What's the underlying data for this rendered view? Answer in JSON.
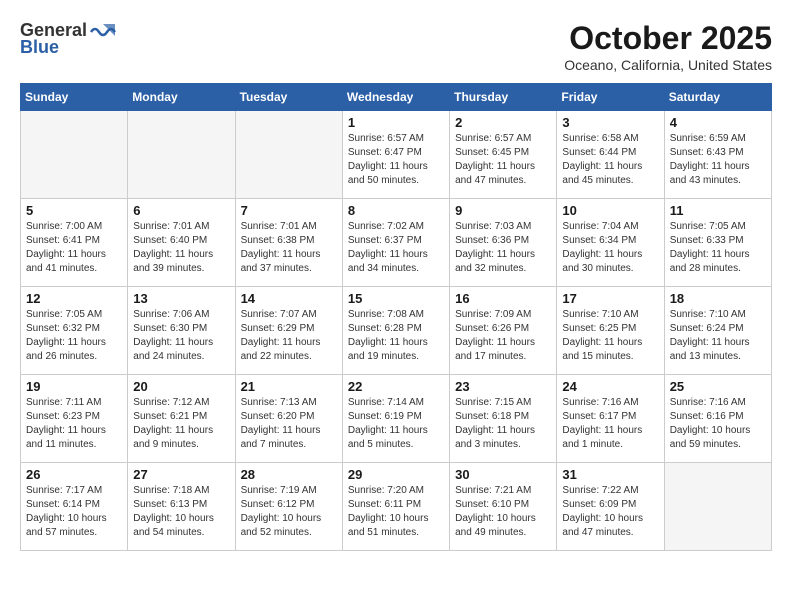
{
  "header": {
    "logo_general": "General",
    "logo_blue": "Blue",
    "month_title": "October 2025",
    "location": "Oceano, California, United States"
  },
  "weekdays": [
    "Sunday",
    "Monday",
    "Tuesday",
    "Wednesday",
    "Thursday",
    "Friday",
    "Saturday"
  ],
  "weeks": [
    [
      {
        "num": "",
        "empty": true
      },
      {
        "num": "",
        "empty": true
      },
      {
        "num": "",
        "empty": true
      },
      {
        "num": "1",
        "info": "Sunrise: 6:57 AM\nSunset: 6:47 PM\nDaylight: 11 hours\nand 50 minutes."
      },
      {
        "num": "2",
        "info": "Sunrise: 6:57 AM\nSunset: 6:45 PM\nDaylight: 11 hours\nand 47 minutes."
      },
      {
        "num": "3",
        "info": "Sunrise: 6:58 AM\nSunset: 6:44 PM\nDaylight: 11 hours\nand 45 minutes."
      },
      {
        "num": "4",
        "info": "Sunrise: 6:59 AM\nSunset: 6:43 PM\nDaylight: 11 hours\nand 43 minutes."
      }
    ],
    [
      {
        "num": "5",
        "info": "Sunrise: 7:00 AM\nSunset: 6:41 PM\nDaylight: 11 hours\nand 41 minutes."
      },
      {
        "num": "6",
        "info": "Sunrise: 7:01 AM\nSunset: 6:40 PM\nDaylight: 11 hours\nand 39 minutes."
      },
      {
        "num": "7",
        "info": "Sunrise: 7:01 AM\nSunset: 6:38 PM\nDaylight: 11 hours\nand 37 minutes."
      },
      {
        "num": "8",
        "info": "Sunrise: 7:02 AM\nSunset: 6:37 PM\nDaylight: 11 hours\nand 34 minutes."
      },
      {
        "num": "9",
        "info": "Sunrise: 7:03 AM\nSunset: 6:36 PM\nDaylight: 11 hours\nand 32 minutes."
      },
      {
        "num": "10",
        "info": "Sunrise: 7:04 AM\nSunset: 6:34 PM\nDaylight: 11 hours\nand 30 minutes."
      },
      {
        "num": "11",
        "info": "Sunrise: 7:05 AM\nSunset: 6:33 PM\nDaylight: 11 hours\nand 28 minutes."
      }
    ],
    [
      {
        "num": "12",
        "info": "Sunrise: 7:05 AM\nSunset: 6:32 PM\nDaylight: 11 hours\nand 26 minutes."
      },
      {
        "num": "13",
        "info": "Sunrise: 7:06 AM\nSunset: 6:30 PM\nDaylight: 11 hours\nand 24 minutes."
      },
      {
        "num": "14",
        "info": "Sunrise: 7:07 AM\nSunset: 6:29 PM\nDaylight: 11 hours\nand 22 minutes."
      },
      {
        "num": "15",
        "info": "Sunrise: 7:08 AM\nSunset: 6:28 PM\nDaylight: 11 hours\nand 19 minutes."
      },
      {
        "num": "16",
        "info": "Sunrise: 7:09 AM\nSunset: 6:26 PM\nDaylight: 11 hours\nand 17 minutes."
      },
      {
        "num": "17",
        "info": "Sunrise: 7:10 AM\nSunset: 6:25 PM\nDaylight: 11 hours\nand 15 minutes."
      },
      {
        "num": "18",
        "info": "Sunrise: 7:10 AM\nSunset: 6:24 PM\nDaylight: 11 hours\nand 13 minutes."
      }
    ],
    [
      {
        "num": "19",
        "info": "Sunrise: 7:11 AM\nSunset: 6:23 PM\nDaylight: 11 hours\nand 11 minutes."
      },
      {
        "num": "20",
        "info": "Sunrise: 7:12 AM\nSunset: 6:21 PM\nDaylight: 11 hours\nand 9 minutes."
      },
      {
        "num": "21",
        "info": "Sunrise: 7:13 AM\nSunset: 6:20 PM\nDaylight: 11 hours\nand 7 minutes."
      },
      {
        "num": "22",
        "info": "Sunrise: 7:14 AM\nSunset: 6:19 PM\nDaylight: 11 hours\nand 5 minutes."
      },
      {
        "num": "23",
        "info": "Sunrise: 7:15 AM\nSunset: 6:18 PM\nDaylight: 11 hours\nand 3 minutes."
      },
      {
        "num": "24",
        "info": "Sunrise: 7:16 AM\nSunset: 6:17 PM\nDaylight: 11 hours\nand 1 minute."
      },
      {
        "num": "25",
        "info": "Sunrise: 7:16 AM\nSunset: 6:16 PM\nDaylight: 10 hours\nand 59 minutes."
      }
    ],
    [
      {
        "num": "26",
        "info": "Sunrise: 7:17 AM\nSunset: 6:14 PM\nDaylight: 10 hours\nand 57 minutes."
      },
      {
        "num": "27",
        "info": "Sunrise: 7:18 AM\nSunset: 6:13 PM\nDaylight: 10 hours\nand 54 minutes."
      },
      {
        "num": "28",
        "info": "Sunrise: 7:19 AM\nSunset: 6:12 PM\nDaylight: 10 hours\nand 52 minutes."
      },
      {
        "num": "29",
        "info": "Sunrise: 7:20 AM\nSunset: 6:11 PM\nDaylight: 10 hours\nand 51 minutes."
      },
      {
        "num": "30",
        "info": "Sunrise: 7:21 AM\nSunset: 6:10 PM\nDaylight: 10 hours\nand 49 minutes."
      },
      {
        "num": "31",
        "info": "Sunrise: 7:22 AM\nSunset: 6:09 PM\nDaylight: 10 hours\nand 47 minutes."
      },
      {
        "num": "",
        "empty": true
      }
    ]
  ]
}
